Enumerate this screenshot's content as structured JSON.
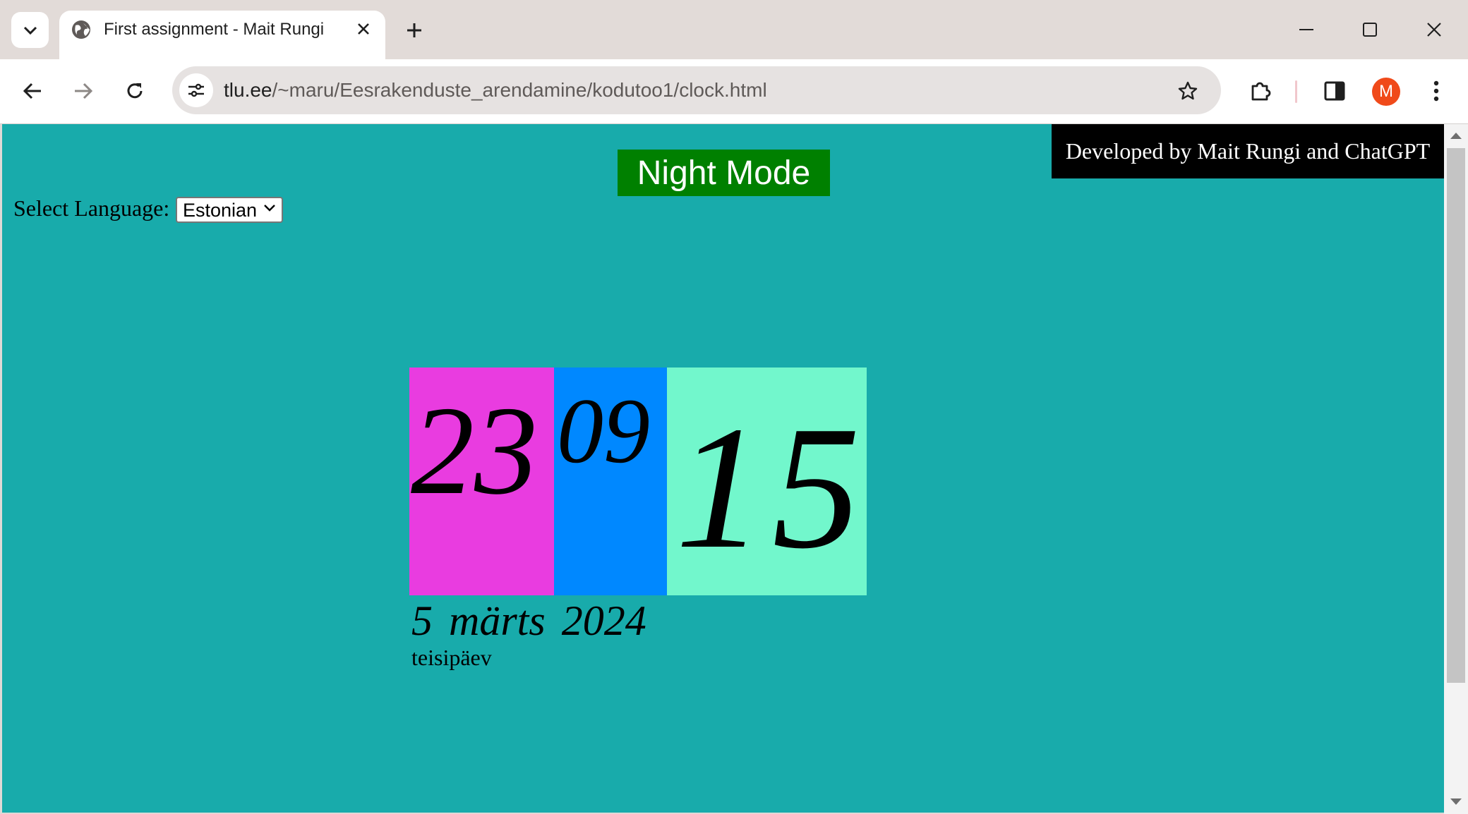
{
  "browser": {
    "tab": {
      "title": "First assignment - Mait Rungi"
    },
    "omnibox": {
      "url_host": "tlu.ee",
      "url_path": "/~maru/Eesrakenduste_arendamine/kodutoo1/clock.html"
    },
    "profile": {
      "initial": "M",
      "color": "#f04a1a"
    }
  },
  "page": {
    "background": "#18abab",
    "night_mode_button": "Night Mode",
    "developer_banner": "Developed by Mait Rungi and ChatGPT",
    "language": {
      "label": "Select Language:",
      "selected": "Estonian"
    },
    "clock": {
      "hours": "23",
      "minutes": "09",
      "seconds": "15",
      "colors": {
        "hours": "#e93ce0",
        "minutes": "#0088ff",
        "seconds": "#72f7cc"
      }
    },
    "date": "5 märts 2024",
    "weekday": "teisipäev"
  }
}
